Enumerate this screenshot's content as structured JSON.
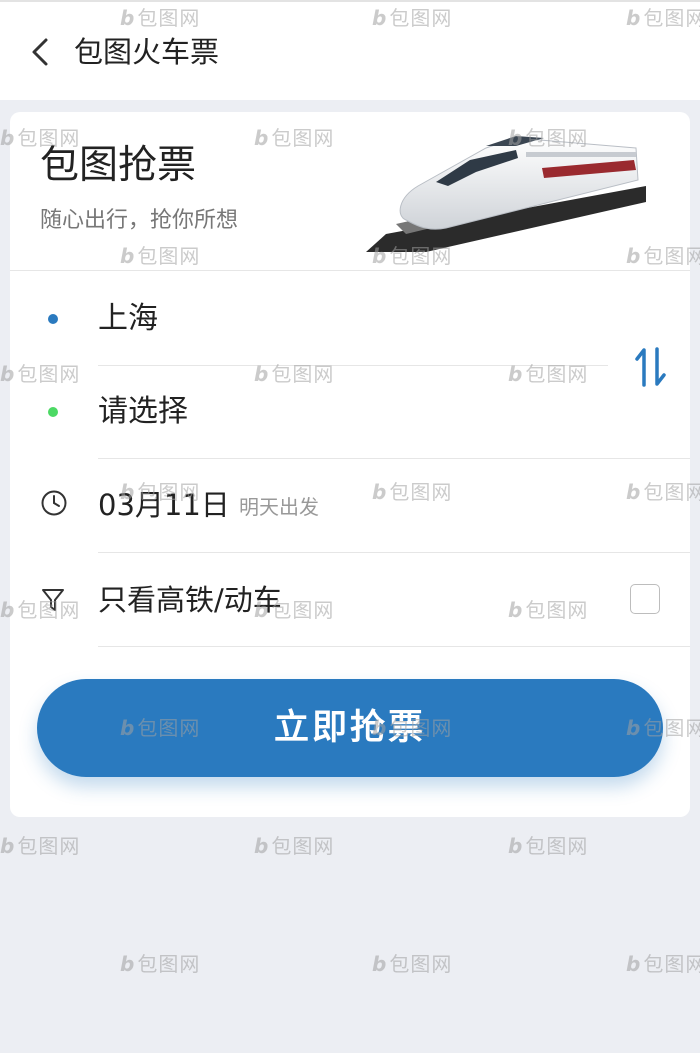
{
  "header": {
    "title": "包图火车票"
  },
  "hero": {
    "title": "包图抢票",
    "subtitle": "随心出行，抢你所想"
  },
  "route": {
    "from_station": "上海",
    "to_station": "请选择",
    "from_dot_color": "#2a7abf",
    "to_dot_color": "#4cd964"
  },
  "date": {
    "value": "03月11日",
    "hint": "明天出发"
  },
  "filter": {
    "label": "只看高铁/动车",
    "checked": false
  },
  "action": {
    "label": "立即抢票"
  },
  "colors": {
    "accent": "#2a7abf",
    "background": "#eceef3"
  },
  "watermark": {
    "text": "包图网",
    "logo_letter": "b"
  }
}
